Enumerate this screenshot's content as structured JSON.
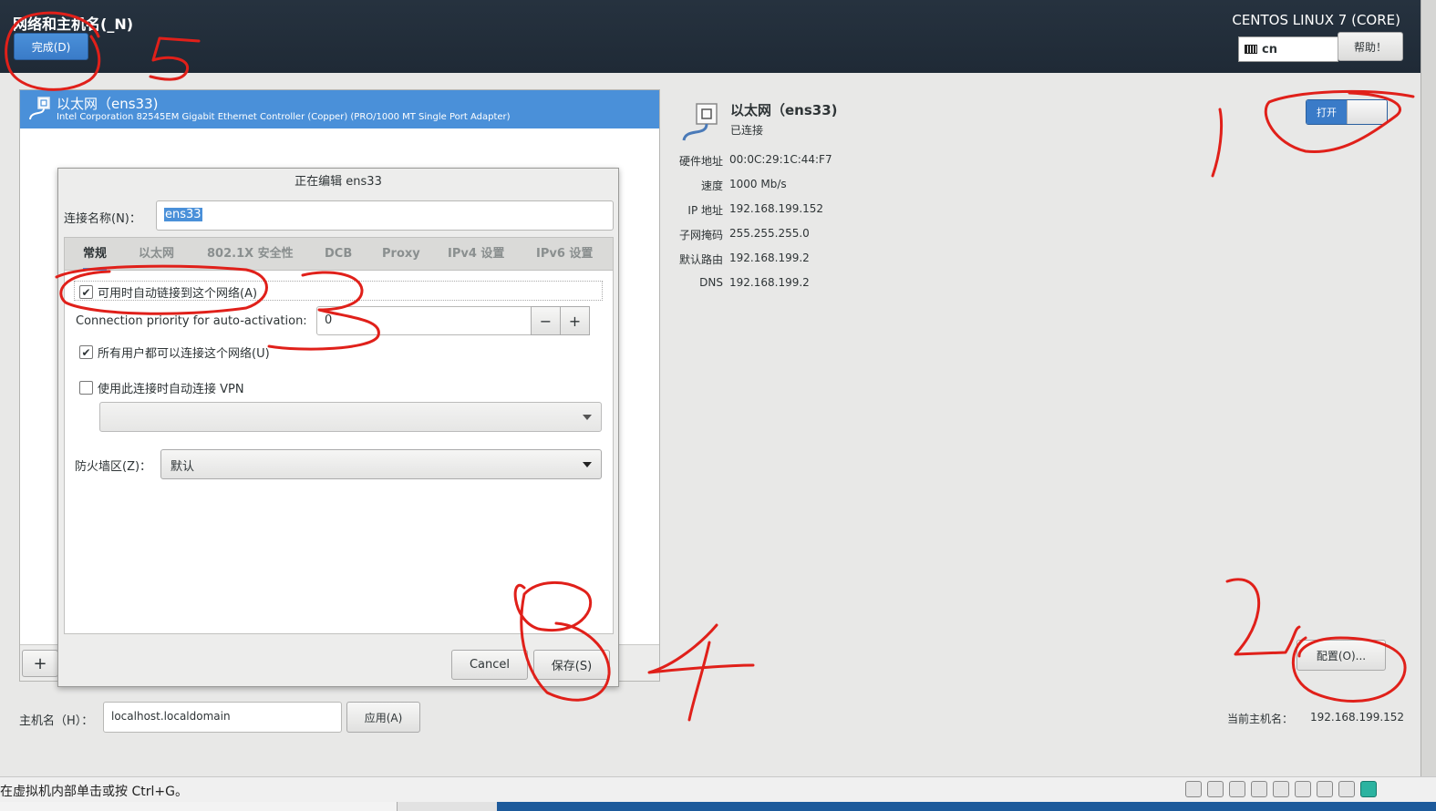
{
  "header": {
    "title": "网络和主机名(_N)",
    "done_label": "完成(D)",
    "os_title": "CENTOS LINUX 7 (CORE)",
    "keyboard_layout": "cn",
    "help_label": "帮助！"
  },
  "connection": {
    "name": "以太网（ens33)",
    "description": "Intel Corporation 82545EM Gigabit Ethernet Controller (Copper) (PRO/1000 MT Single Port Adapter)"
  },
  "dialog": {
    "title": "正在编辑 ens33",
    "name_label": "连接名称(N)：",
    "name_value": "ens33",
    "tabs": [
      "常规",
      "以太网",
      "802.1X 安全性",
      "DCB",
      "Proxy",
      "IPv4 设置",
      "IPv6 设置"
    ],
    "auto_connect_label": "可用时自动链接到这个网络(A)",
    "priority_label": "Connection priority for auto-activation:",
    "priority_value": "0",
    "minus": "−",
    "plus": "+",
    "all_users_label": "所有用户都可以连接这个网络(U)",
    "vpn_label": "使用此连接时自动连接 VPN",
    "firewall_label": "防火墙区(Z)：",
    "firewall_value": "默认",
    "cancel_label": "Cancel",
    "save_label": "保存(S)"
  },
  "left": {
    "add_label": "+"
  },
  "hostname": {
    "label": "主机名（H）：",
    "value": "localhost.localdomain",
    "apply_label": "应用(A)"
  },
  "details": {
    "name": "以太网（ens33)",
    "status": "已连接",
    "toggle_label": "打开",
    "rows": [
      {
        "label": "硬件地址",
        "value": "00:0C:29:1C:44:F7"
      },
      {
        "label": "速度",
        "value": "1000 Mb/s"
      },
      {
        "label": "IP 地址",
        "value": "192.168.199.152"
      },
      {
        "label": "子网掩码",
        "value": "255.255.255.0"
      },
      {
        "label": "默认路由",
        "value": "192.168.199.2"
      },
      {
        "label": "DNS",
        "value": "192.168.199.2"
      }
    ],
    "config_label": "配置(O)...",
    "current_host_label": "当前主机名：",
    "current_host_value": "192.168.199.152"
  },
  "statusbar": {
    "text": "在虚拟机内部单击或按 Ctrl+G。"
  },
  "colors": {
    "accent": "#4a90d9",
    "header_bg": "#26323f",
    "annotation": "#e0201a"
  }
}
